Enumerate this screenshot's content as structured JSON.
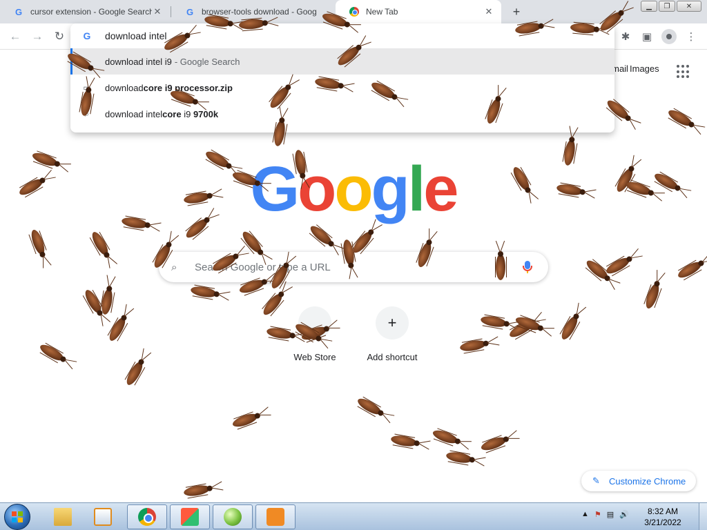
{
  "browser": {
    "tabs": [
      {
        "title": "cursor extension - Google Search",
        "favicon": "google-g-icon",
        "active": false
      },
      {
        "title": "browser-tools download - Goog",
        "favicon": "google-g-icon",
        "active": false
      },
      {
        "title": "New Tab",
        "favicon": "chrome-icon",
        "active": true
      }
    ],
    "new_tab_symbol": "+",
    "tab_close_symbol": "✕",
    "tab_search_symbol": "⌄",
    "window_controls": {
      "minimize": "▁",
      "maximize": "❐",
      "close": "✕"
    }
  },
  "toolbar": {
    "back_symbol": "←",
    "forward_symbol": "→",
    "reload_symbol": "↻",
    "extensions_symbol": "✱",
    "sidepanel_symbol": "▣",
    "menu_symbol": "⋮"
  },
  "omnibox": {
    "typed_text": "download intel",
    "suggestions": [
      {
        "prefix": "download intel i9",
        "suffix": " - Google Search",
        "bold": "",
        "selected": true,
        "icon": "google-g-icon"
      },
      {
        "prefix": "download ",
        "bold": "core i9 processor.zip",
        "suffix": "",
        "selected": false,
        "icon": "file-icon"
      },
      {
        "prefix": "download intel ",
        "bold": "core",
        "suffix": " i9 ",
        "bold2": "9700k",
        "selected": false,
        "icon": "search-icon"
      }
    ]
  },
  "ntp": {
    "header_links": {
      "gmail": "Gmail",
      "images": "Images"
    },
    "logo_letters": [
      "G",
      "o",
      "o",
      "g",
      "l",
      "e"
    ],
    "logo_colors": [
      "#4285f4",
      "#ea4335",
      "#fbbc05",
      "#4285f4",
      "#34a853",
      "#ea4335"
    ],
    "search_placeholder": "Search Google or type a URL",
    "shortcuts": [
      {
        "label": "Web Store",
        "icon": "web-store-icon",
        "symbol": ""
      },
      {
        "label": "Add shortcut",
        "icon": "plus-icon",
        "symbol": "+"
      }
    ],
    "customize_label": "Customize Chrome",
    "customize_symbol": "✎"
  },
  "taskbar": {
    "apps": [
      "windows-explorer-icon",
      "media-player-icon",
      "chrome-icon",
      "app-squares-icon",
      "app-ball-icon",
      "app-orange-icon"
    ],
    "tray_symbols": [
      "▲",
      "⚑",
      "▤",
      "🔊"
    ],
    "time": "8:32 AM",
    "date": "3/21/2022"
  },
  "colors": {
    "accent": "#1a73e8",
    "tabstrip_bg": "#dee1e6",
    "taskbar_top": "#d6e4f2"
  },
  "overlay": {
    "description_icon": "cockroach-icon"
  }
}
